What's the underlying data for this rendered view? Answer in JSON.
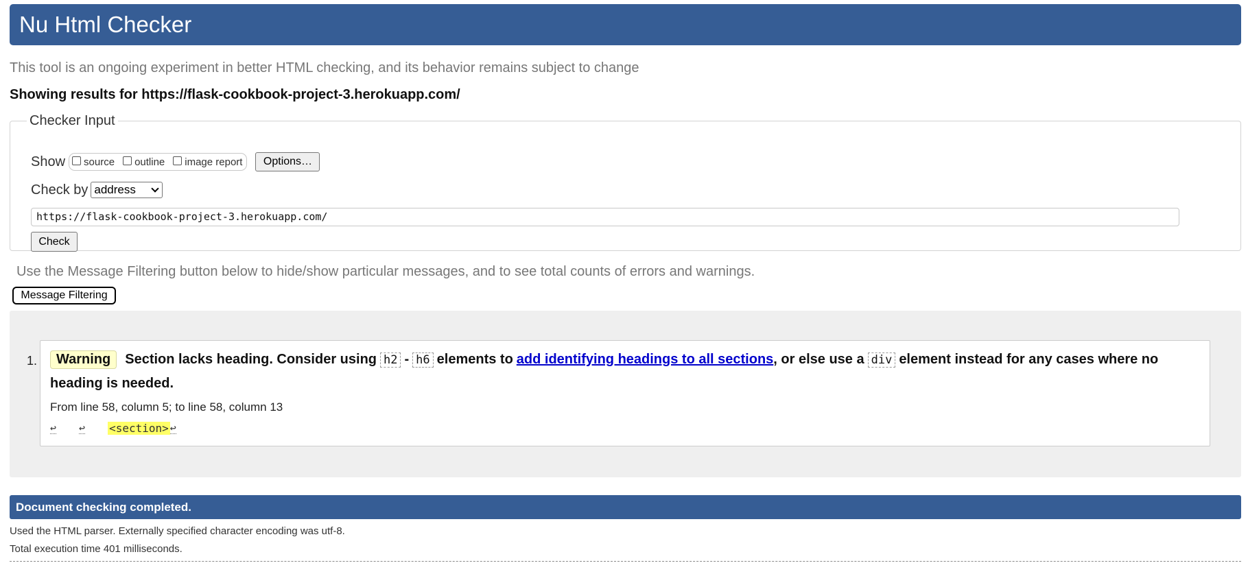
{
  "header": {
    "title": "Nu Html Checker"
  },
  "intro": "This tool is an ongoing experiment in better HTML checking, and its behavior remains subject to change",
  "results_for": "Showing results for https://flask-cookbook-project-3.herokuapp.com/",
  "checker_input": {
    "legend": "Checker Input",
    "show_label": "Show",
    "show_options": [
      {
        "label": "source",
        "checked": false
      },
      {
        "label": "outline",
        "checked": false
      },
      {
        "label": "image report",
        "checked": false
      }
    ],
    "options_button": "Options…",
    "check_by_label": "Check by",
    "check_by_value": "address",
    "url_value": "https://flask-cookbook-project-3.herokuapp.com/",
    "check_button": "Check"
  },
  "filter": {
    "text": "Use the Message Filtering button below to hide/show particular messages, and to see total counts of errors and warnings.",
    "button": "Message Filtering"
  },
  "messages": [
    {
      "number": "1.",
      "type": "Warning",
      "text_a": "Section lacks heading. Consider using",
      "code_1": "h2",
      "dash": "-",
      "code_2": "h6",
      "text_b": "elements to",
      "link": "add identifying headings to all sections",
      "text_c": ", or else use a",
      "code_3": "div",
      "text_d": "element instead for any cases where no",
      "text_e": "heading is needed.",
      "location": "From line 58, column 5; to line 58, column 13",
      "extract_return": "↩",
      "extract_tag": "<section>"
    }
  ],
  "status": {
    "completed": "Document checking completed.",
    "parser_info": "Used the HTML parser. Externally specified character encoding was utf-8.",
    "execution_time": "Total execution time 401 milliseconds."
  },
  "colors": {
    "header_bg": "#365d95",
    "warning_badge_bg": "#ffffcc",
    "highlight": "#ffff66",
    "link": "#0000cc"
  }
}
